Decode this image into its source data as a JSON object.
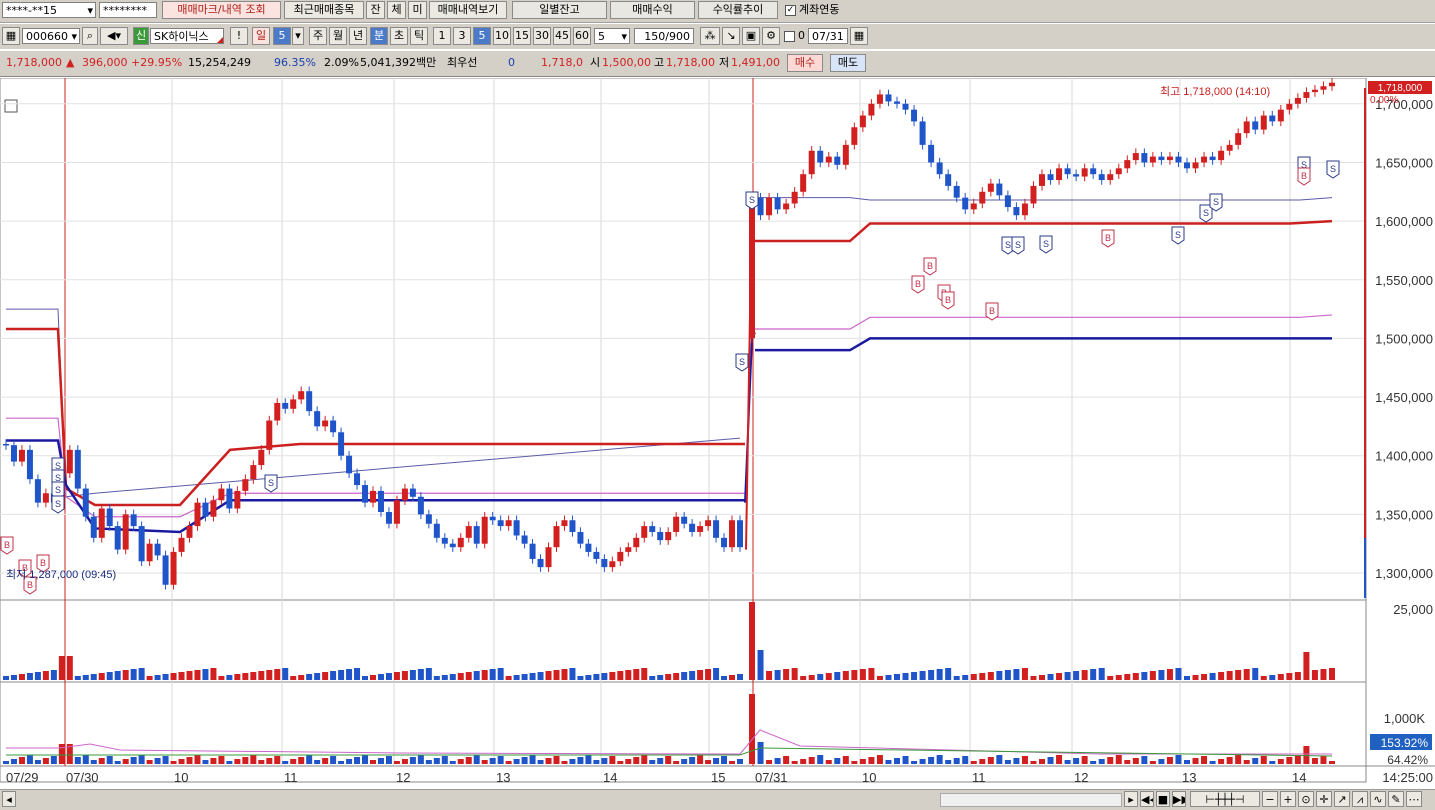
{
  "toolbar1": {
    "account": "****-**15",
    "password": "********",
    "tab_mark": "매매마크/내역 조회",
    "tab_recent": "최근매매종목",
    "tab_jan": "잔",
    "tab_che": "체",
    "tab_mi": "미",
    "tab_history": "매매내역보기",
    "btn_daily": "일별잔고",
    "btn_profit": "매매수익",
    "btn_rate": "수익률추이",
    "link_label": "계좌연동"
  },
  "toolbar2": {
    "code": "000660",
    "credit": "신",
    "stock_name": "SK하이닉스",
    "warn": "!",
    "period_day": "일",
    "period_num": "5",
    "periods": [
      "주",
      "월",
      "년",
      "분",
      "초",
      "틱"
    ],
    "intervals": [
      "1",
      "3",
      "5",
      "10",
      "15",
      "30",
      "45",
      "60"
    ],
    "count": "5",
    "range": "150/900",
    "date": "07/31",
    "zero": "0"
  },
  "quote": {
    "price": "1,718,000",
    "change": "396,000",
    "rate": "+29.95%",
    "volume": "15,254,249",
    "ratio": "96.35%",
    "turnover": "2.09%",
    "amount": "5,041,392백만",
    "prefer_label": "최우선",
    "prefer_val": "0",
    "ask": "1,718,0",
    "open_label": "시",
    "open": "1,500,00",
    "high_label": "고",
    "high": "1,718,00",
    "low_label": "저",
    "low": "1,491,00",
    "buy": "매수",
    "sell": "매도"
  },
  "colors": {
    "up": "#d21f1f",
    "down": "#1f55c8",
    "ma_red": "#cc1f1f",
    "ma_navy": "#1a1aa0",
    "ma_pink": "#cc66cc",
    "ma_blue": "#5a5aa8"
  },
  "chart_data": {
    "type": "candlestick",
    "y_ticks": [
      "1,700,000",
      "1,650,000",
      "1,600,000",
      "1,550,000",
      "1,500,000",
      "1,450,000",
      "1,400,000",
      "1,350,000",
      "1,300,000"
    ],
    "price_range": [
      1277000,
      1722000
    ],
    "high_label": "최고 1,718,000 (14:10)",
    "low_label": "최저 1,287,000 (09:45)",
    "cur_price_label": "1,718,000",
    "cur_rate_label": "0.00%",
    "volume_tick": "25,000",
    "vol2_tick": "1,000K",
    "vol2_labels": [
      "153.92%",
      "64.42%"
    ],
    "x_labels": [
      "07/29",
      "07/30",
      "10",
      "11",
      "12",
      "13",
      "14",
      "15",
      "07/31",
      "10",
      "11",
      "12",
      "13",
      "14"
    ],
    "time_label": "14:25:00",
    "candles_day1": [
      [
        1410000,
        1409000
      ],
      [
        1409000,
        1395000
      ],
      [
        1395000,
        1405000
      ],
      [
        1405000,
        1380000
      ],
      [
        1380000,
        1360000
      ],
      [
        1360000,
        1368000
      ],
      [
        1368000,
        1360000
      ],
      [
        1360000,
        1385000
      ],
      [
        1385000,
        1405000
      ],
      [
        1405000,
        1372000
      ],
      [
        1372000,
        1348000
      ],
      [
        1348000,
        1330000
      ],
      [
        1330000,
        1355000
      ],
      [
        1355000,
        1340000
      ],
      [
        1340000,
        1320000
      ],
      [
        1320000,
        1350000
      ],
      [
        1350000,
        1340000
      ],
      [
        1340000,
        1310000
      ],
      [
        1310000,
        1325000
      ],
      [
        1325000,
        1315000
      ],
      [
        1315000,
        1290000
      ],
      [
        1290000,
        1318000
      ],
      [
        1318000,
        1330000
      ],
      [
        1330000,
        1340000
      ],
      [
        1340000,
        1360000
      ],
      [
        1360000,
        1348000
      ],
      [
        1348000,
        1362000
      ],
      [
        1362000,
        1372000
      ],
      [
        1372000,
        1355000
      ],
      [
        1355000,
        1370000
      ],
      [
        1370000,
        1380000
      ],
      [
        1380000,
        1392000
      ],
      [
        1392000,
        1405000
      ],
      [
        1405000,
        1430000
      ],
      [
        1430000,
        1445000
      ],
      [
        1445000,
        1440000
      ],
      [
        1440000,
        1448000
      ],
      [
        1448000,
        1455000
      ],
      [
        1455000,
        1438000
      ],
      [
        1438000,
        1425000
      ],
      [
        1425000,
        1430000
      ],
      [
        1430000,
        1420000
      ],
      [
        1420000,
        1400000
      ],
      [
        1400000,
        1385000
      ],
      [
        1385000,
        1375000
      ],
      [
        1375000,
        1360000
      ],
      [
        1360000,
        1370000
      ],
      [
        1370000,
        1352000
      ],
      [
        1352000,
        1342000
      ],
      [
        1342000,
        1362000
      ],
      [
        1362000,
        1372000
      ],
      [
        1372000,
        1365000
      ],
      [
        1365000,
        1350000
      ],
      [
        1350000,
        1342000
      ],
      [
        1342000,
        1330000
      ],
      [
        1330000,
        1325000
      ],
      [
        1325000,
        1322000
      ],
      [
        1322000,
        1330000
      ],
      [
        1330000,
        1340000
      ],
      [
        1340000,
        1325000
      ],
      [
        1325000,
        1348000
      ],
      [
        1348000,
        1345000
      ],
      [
        1345000,
        1340000
      ],
      [
        1340000,
        1345000
      ],
      [
        1345000,
        1332000
      ],
      [
        1332000,
        1325000
      ],
      [
        1325000,
        1312000
      ],
      [
        1312000,
        1305000
      ],
      [
        1305000,
        1322000
      ],
      [
        1322000,
        1340000
      ],
      [
        1340000,
        1345000
      ],
      [
        1345000,
        1335000
      ],
      [
        1335000,
        1325000
      ],
      [
        1325000,
        1318000
      ],
      [
        1318000,
        1312000
      ],
      [
        1312000,
        1305000
      ],
      [
        1305000,
        1310000
      ],
      [
        1310000,
        1318000
      ],
      [
        1318000,
        1322000
      ],
      [
        1322000,
        1330000
      ],
      [
        1330000,
        1340000
      ],
      [
        1340000,
        1335000
      ],
      [
        1335000,
        1328000
      ],
      [
        1328000,
        1335000
      ],
      [
        1335000,
        1348000
      ],
      [
        1348000,
        1342000
      ],
      [
        1342000,
        1335000
      ],
      [
        1335000,
        1340000
      ],
      [
        1340000,
        1345000
      ],
      [
        1345000,
        1330000
      ],
      [
        1330000,
        1322000
      ],
      [
        1322000,
        1345000
      ],
      [
        1345000,
        1322000
      ]
    ],
    "candles_day2": [
      [
        1500000,
        1620000
      ],
      [
        1620000,
        1605000
      ],
      [
        1605000,
        1620000
      ],
      [
        1620000,
        1610000
      ],
      [
        1610000,
        1615000
      ],
      [
        1615000,
        1625000
      ],
      [
        1625000,
        1640000
      ],
      [
        1640000,
        1660000
      ],
      [
        1660000,
        1650000
      ],
      [
        1650000,
        1655000
      ],
      [
        1655000,
        1648000
      ],
      [
        1648000,
        1665000
      ],
      [
        1665000,
        1680000
      ],
      [
        1680000,
        1690000
      ],
      [
        1690000,
        1700000
      ],
      [
        1700000,
        1708000
      ],
      [
        1708000,
        1702000
      ],
      [
        1702000,
        1700000
      ],
      [
        1700000,
        1695000
      ],
      [
        1695000,
        1685000
      ],
      [
        1685000,
        1665000
      ],
      [
        1665000,
        1650000
      ],
      [
        1650000,
        1640000
      ],
      [
        1640000,
        1630000
      ],
      [
        1630000,
        1620000
      ],
      [
        1620000,
        1610000
      ],
      [
        1610000,
        1615000
      ],
      [
        1615000,
        1625000
      ],
      [
        1625000,
        1632000
      ],
      [
        1632000,
        1622000
      ],
      [
        1622000,
        1612000
      ],
      [
        1612000,
        1605000
      ],
      [
        1605000,
        1615000
      ],
      [
        1615000,
        1630000
      ],
      [
        1630000,
        1640000
      ],
      [
        1640000,
        1635000
      ],
      [
        1635000,
        1645000
      ],
      [
        1645000,
        1640000
      ],
      [
        1640000,
        1638000
      ],
      [
        1638000,
        1645000
      ],
      [
        1645000,
        1640000
      ],
      [
        1640000,
        1635000
      ],
      [
        1635000,
        1640000
      ],
      [
        1640000,
        1645000
      ],
      [
        1645000,
        1652000
      ],
      [
        1652000,
        1658000
      ],
      [
        1658000,
        1650000
      ],
      [
        1650000,
        1655000
      ],
      [
        1655000,
        1652000
      ],
      [
        1652000,
        1655000
      ],
      [
        1655000,
        1650000
      ],
      [
        1650000,
        1645000
      ],
      [
        1645000,
        1650000
      ],
      [
        1650000,
        1655000
      ],
      [
        1655000,
        1652000
      ],
      [
        1652000,
        1660000
      ],
      [
        1660000,
        1665000
      ],
      [
        1665000,
        1675000
      ],
      [
        1675000,
        1685000
      ],
      [
        1685000,
        1678000
      ],
      [
        1678000,
        1690000
      ],
      [
        1690000,
        1685000
      ],
      [
        1685000,
        1695000
      ],
      [
        1695000,
        1700000
      ],
      [
        1700000,
        1705000
      ],
      [
        1705000,
        1710000
      ],
      [
        1710000,
        1712000
      ],
      [
        1712000,
        1715000
      ],
      [
        1715000,
        1718000
      ]
    ],
    "markers": [
      "B",
      "S"
    ]
  }
}
